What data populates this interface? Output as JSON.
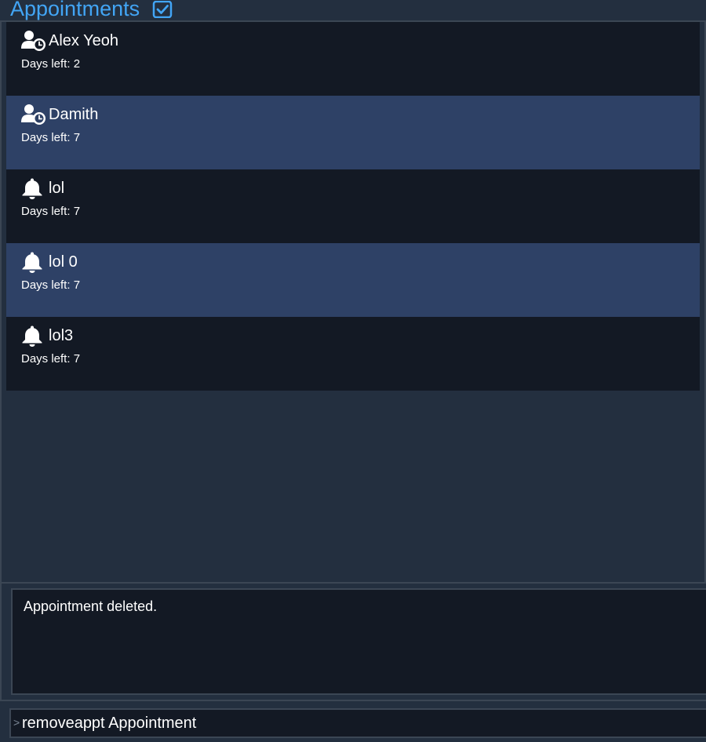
{
  "header": {
    "title": "Appointments",
    "title_icon": "checkbox-checked-icon",
    "accent_color": "#42a5f5"
  },
  "appointments": [
    {
      "icon": "person-clock-icon",
      "name": "Alex Yeoh",
      "days_label": "Days left:",
      "days_value": "2"
    },
    {
      "icon": "person-clock-icon",
      "name": "Damith",
      "days_label": "Days left:",
      "days_value": "7"
    },
    {
      "icon": "bell-icon",
      "name": "lol",
      "days_label": "Days left:",
      "days_value": "7"
    },
    {
      "icon": "bell-icon",
      "name": "lol 0",
      "days_label": "Days left:",
      "days_value": "7"
    },
    {
      "icon": "bell-icon",
      "name": "lol3",
      "days_label": "Days left:",
      "days_value": "7"
    }
  ],
  "result": {
    "message": "Appointment deleted."
  },
  "command": {
    "prompt": ">",
    "value": "removeappt Appointment"
  },
  "colors": {
    "background": "#232f3f",
    "row_dark": "#131924",
    "row_highlight": "#2e4166",
    "border": "#3b4654"
  }
}
